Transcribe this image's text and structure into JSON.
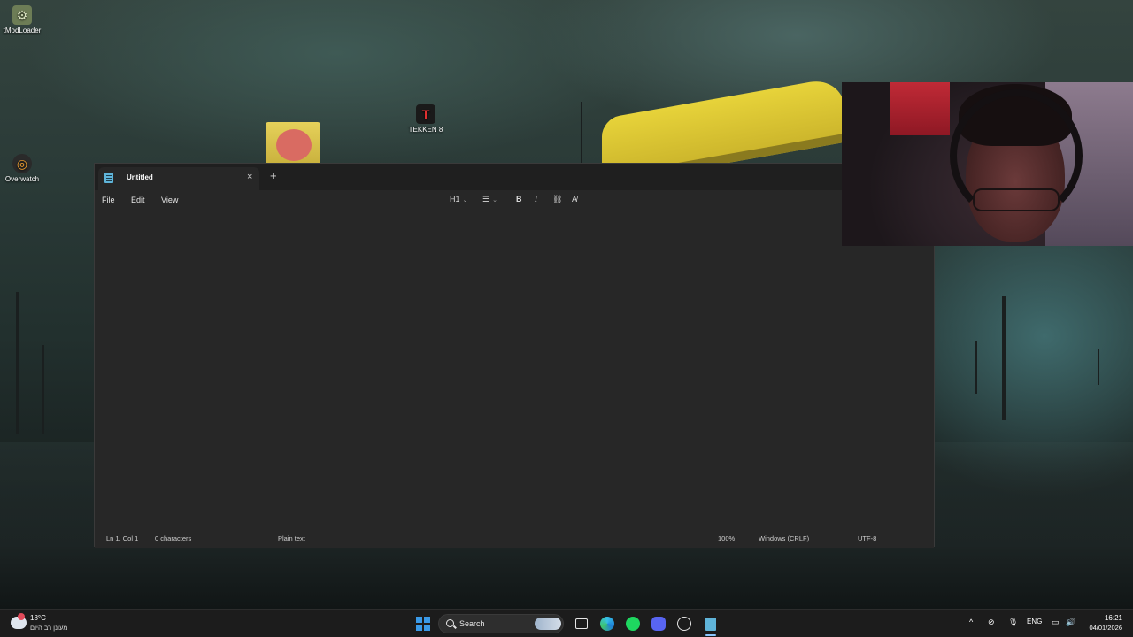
{
  "desktop": {
    "icons": [
      {
        "label": "tModLoader"
      },
      {
        "label": "Overwatch"
      },
      {
        "label": "TEKKEN 8"
      }
    ]
  },
  "notepad": {
    "tab_title": "Untitled",
    "tab_close": "×",
    "new_tab": "+",
    "menu": {
      "file": "File",
      "edit": "Edit",
      "view": "View"
    },
    "toolbar": {
      "heading": "H1",
      "list": "☰",
      "bold": "B",
      "italic": "I",
      "link": "⛓",
      "clear_format": "A̸"
    },
    "editor_text": "",
    "status": {
      "position": "Ln 1, Col 1",
      "characters": "0 characters",
      "format": "Plain text",
      "zoom": "100%",
      "line_ending": "Windows (CRLF)",
      "encoding": "UTF-8"
    }
  },
  "taskbar": {
    "weather": {
      "temp": "18°C",
      "description": "מעונן רב היום"
    },
    "search": {
      "label": "Search"
    },
    "tray": {
      "language": "ENG",
      "chevron": "^"
    },
    "clock": {
      "time": "16:21",
      "date": "04/01/2026"
    }
  },
  "colors": {
    "accent": "#3a9ae8",
    "window_bg": "#272727",
    "titlebar_bg": "#1f1f1f",
    "taskbar_bg": "#1c1c1c"
  }
}
